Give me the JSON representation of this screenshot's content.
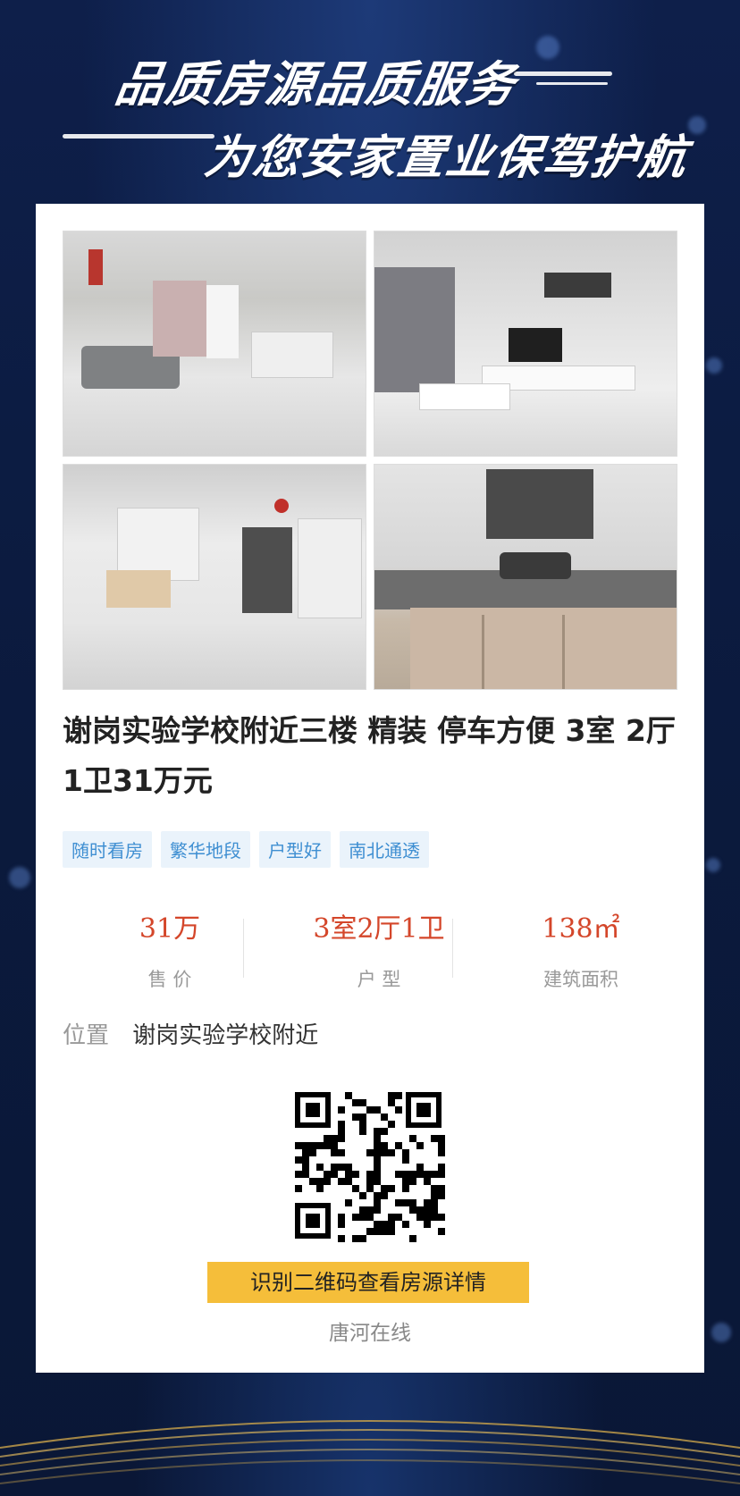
{
  "header": {
    "line1": "品质房源品质服务",
    "line2": "为您安家置业保驾护航"
  },
  "listing": {
    "photos": [
      "living-room-photo-1",
      "living-room-photo-2",
      "dining-area-photo",
      "kitchen-photo"
    ],
    "title": "谢岗实验学校附近三楼 精装 停车方便 3室 2厅 1卫31万元",
    "tags": [
      "随时看房",
      "繁华地段",
      "户型好",
      "南北通透"
    ],
    "stats": [
      {
        "value": "31万",
        "label": "售 价"
      },
      {
        "value": "3室2厅1卫",
        "label": "户 型"
      },
      {
        "value": "138㎡",
        "label": "建筑面积"
      }
    ],
    "location_label": "位置",
    "location_value": "谢岗实验学校附近",
    "cta": "识别二维码查看房源详情",
    "brand": "唐河在线"
  },
  "colors": {
    "background": "#0e1f4a",
    "price_red": "#d4462a",
    "tag_blue": "#3f8fd2",
    "cta_yellow": "#f5be3a"
  }
}
